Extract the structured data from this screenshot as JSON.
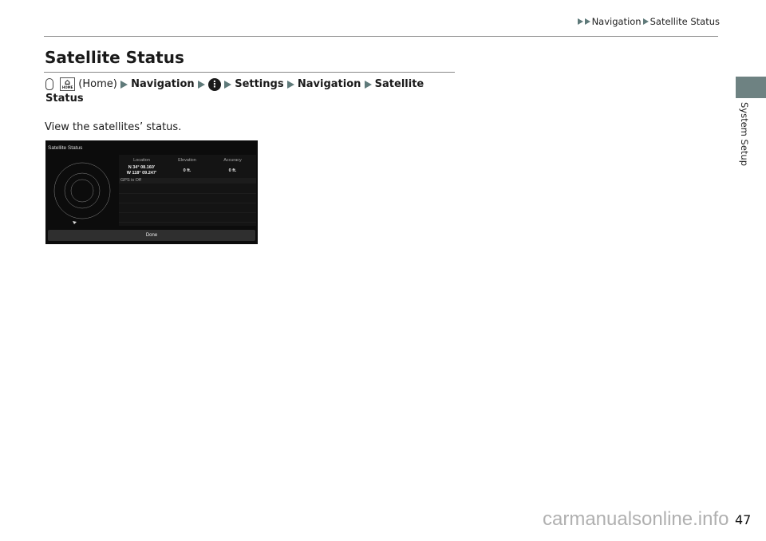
{
  "header": {
    "breadcrumb": [
      "Navigation",
      "Satellite Status"
    ]
  },
  "section": {
    "title": "Satellite Status",
    "path": {
      "home_label": "HOME",
      "home_text": "(Home)",
      "steps": [
        "Navigation",
        "Settings",
        "Navigation",
        "Satellite Status"
      ],
      "menu_icon": "more-options-icon"
    },
    "description": "View the satellites’ status."
  },
  "screen": {
    "title": "Satellite Status",
    "columns": [
      {
        "header": "Location",
        "value_lines": [
          "N 34° 08.160'",
          "W 118° 09.247'"
        ]
      },
      {
        "header": "Elevation",
        "value_lines": [
          "0 ft."
        ]
      },
      {
        "header": "Accuracy",
        "value_lines": [
          "0 ft."
        ]
      }
    ],
    "gps_status": "GPS is Off",
    "done_label": "Done"
  },
  "side_tab": {
    "label": "System Setup",
    "color": "#6e8282"
  },
  "page_number": "47",
  "watermark": "carmanualsonline.info"
}
